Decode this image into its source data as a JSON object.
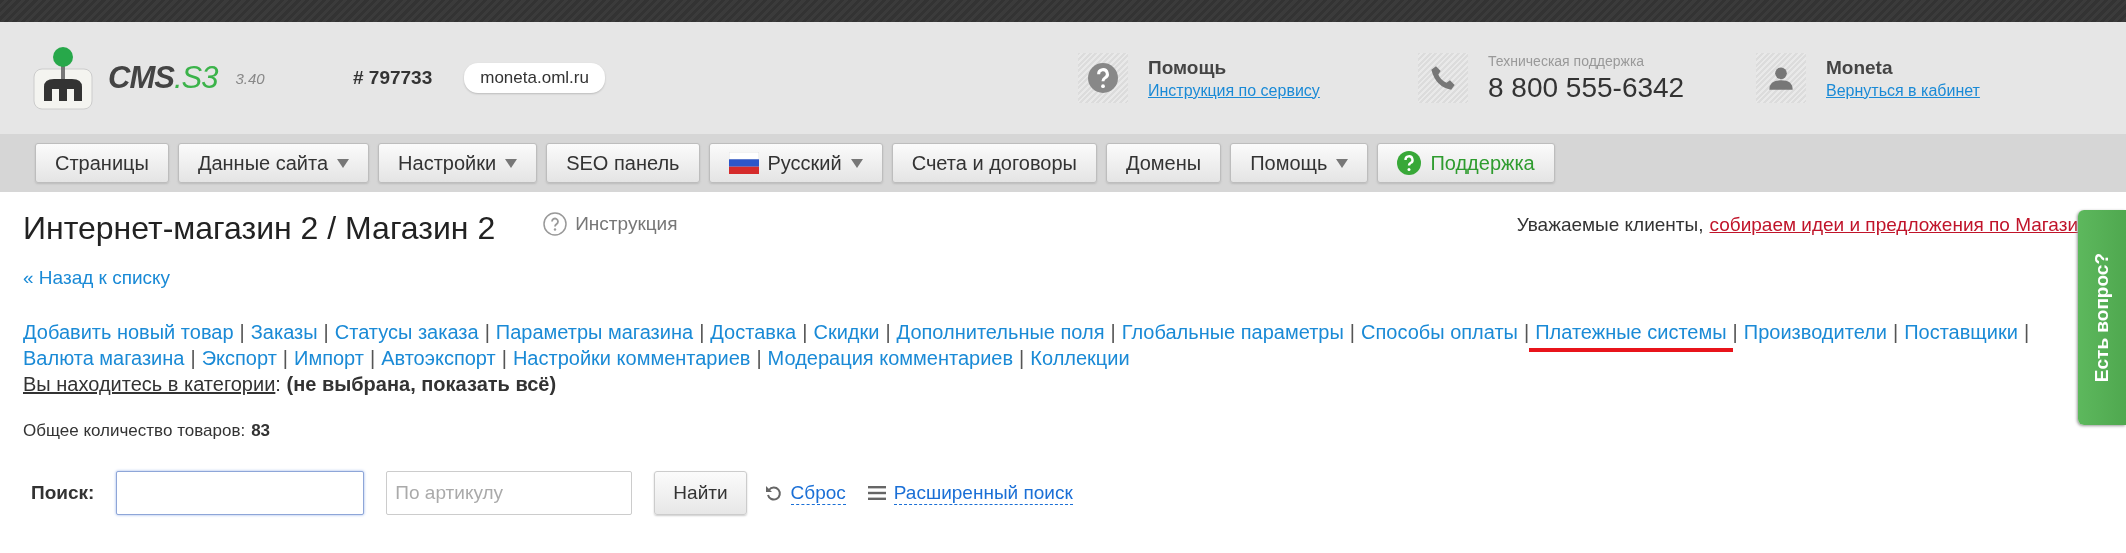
{
  "header": {
    "logo": {
      "name": "CMS",
      "suffix": ".S3",
      "version": "3.40"
    },
    "site_id": "# 797733",
    "domain": "moneta.oml.ru",
    "help": {
      "title": "Помощь",
      "link": "Инструкция по сервису"
    },
    "support": {
      "caption": "Техническая поддержка",
      "phone": "8 800 555-6342"
    },
    "user": {
      "name": "Moneta",
      "link": "Вернуться в кабинет"
    }
  },
  "menu": [
    {
      "label": "Страницы",
      "kind": "plain",
      "dropdown": false
    },
    {
      "label": "Данные сайта",
      "kind": "plain",
      "dropdown": true
    },
    {
      "label": "Настройки",
      "kind": "plain",
      "dropdown": true
    },
    {
      "label": "SEO панель",
      "kind": "plain",
      "dropdown": false
    },
    {
      "label": "Русский",
      "kind": "flag",
      "dropdown": true
    },
    {
      "label": "Счета и договоры",
      "kind": "plain",
      "dropdown": false
    },
    {
      "label": "Домены",
      "kind": "plain",
      "dropdown": false
    },
    {
      "label": "Помощь",
      "kind": "plain",
      "dropdown": true
    },
    {
      "label": "Поддержка",
      "kind": "support",
      "dropdown": false
    }
  ],
  "page": {
    "title": "Интернет-магазин 2 / Магазин 2",
    "instruction": "Инструкция",
    "notice": {
      "text": "Уважаемые клиенты,",
      "link": "собираем идеи и предложения по Магази"
    },
    "back_link": "« Назад к списку",
    "link_rows": [
      [
        {
          "label": "Добавить новый товар",
          "separator": "|"
        },
        {
          "label": "Заказы",
          "separator": "|"
        },
        {
          "label": "Статусы заказа",
          "separator": "|"
        },
        {
          "label": "Параметры магазина",
          "separator": "|"
        },
        {
          "label": "Доставка",
          "separator": "|"
        },
        {
          "label": "Скидки",
          "separator": "|"
        },
        {
          "label": "Дополнительные поля",
          "separator": "|"
        },
        {
          "label": "Глобальные параметры",
          "separator": "|"
        },
        {
          "label": "Способы оплаты",
          "separator": "|"
        },
        {
          "label": "Платежные системы",
          "highlighted": true,
          "separator": "|"
        },
        {
          "label": "Производители",
          "separator": "|"
        },
        {
          "label": "Поставщики",
          "separator": "|"
        }
      ],
      [
        {
          "label": "Валюта магазина",
          "separator": "|"
        },
        {
          "label": "Экспорт",
          "separator": "|"
        },
        {
          "label": "Импорт",
          "separator": "|"
        },
        {
          "label": "Автоэкспорт",
          "separator": "|"
        },
        {
          "label": "Настройки комментариев",
          "separator": "|"
        },
        {
          "label": "Модерация комментариев",
          "separator": "|"
        },
        {
          "label": "Коллекции"
        }
      ]
    ],
    "category": {
      "label": "Вы находитесь в категории",
      "separator": ":",
      "value": "(не выбрана, показать всё)"
    },
    "total": {
      "label": "Общее количество товаров:",
      "value": "83"
    },
    "search": {
      "label": "Поиск:",
      "query": {
        "focused": true
      },
      "article": {
        "placeholder": "По артикулу",
        "focused": false
      },
      "button": "Найти",
      "reset": "Сброс",
      "advanced": "Расширенный поиск"
    }
  },
  "side_tab": {
    "label": "Есть вопрос?"
  }
}
